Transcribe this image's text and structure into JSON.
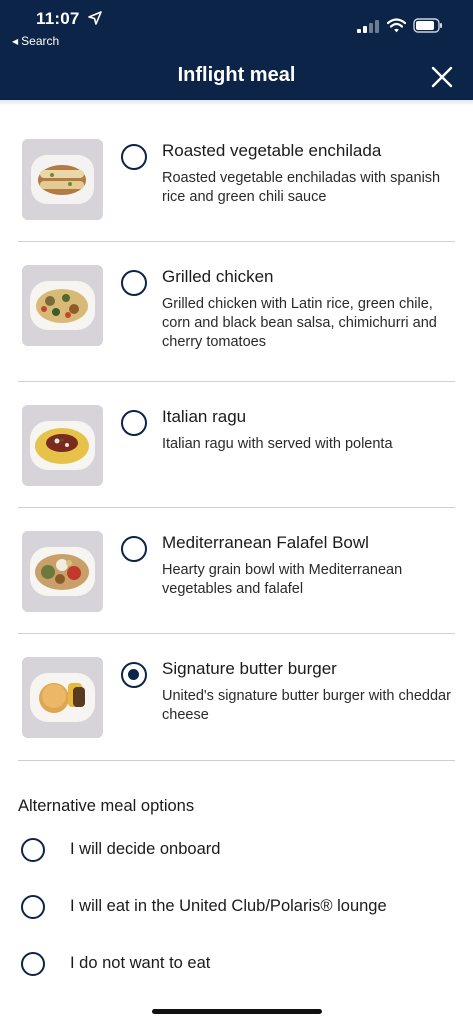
{
  "status_bar": {
    "time": "11:07",
    "back_label": "Search",
    "icons": [
      "location-arrow-icon",
      "cellular-signal-icon",
      "wifi-icon",
      "battery-icon"
    ]
  },
  "header": {
    "title": "Inflight meal",
    "close_icon": "close-icon",
    "background_color": "#0b2447"
  },
  "meals": [
    {
      "name": "Roasted vegetable enchilada",
      "description": "Roasted vegetable enchiladas with spanish rice and green chili sauce",
      "selected": false,
      "image": "enchilada-dish-image"
    },
    {
      "name": "Grilled chicken",
      "description": "Grilled chicken with Latin rice, green chile, corn and black bean salsa, chimichurri and cherry tomatoes",
      "selected": false,
      "image": "grilled-chicken-dish-image"
    },
    {
      "name": "Italian ragu",
      "description": "Italian ragu with served with polenta",
      "selected": false,
      "image": "italian-ragu-dish-image"
    },
    {
      "name": "Mediterranean Falafel Bowl",
      "description": "Hearty grain bowl with Mediterranean vegetables and falafel",
      "selected": false,
      "image": "falafel-bowl-dish-image"
    },
    {
      "name": "Signature butter burger",
      "description": "United's signature butter burger with cheddar cheese",
      "selected": true,
      "image": "butter-burger-dish-image"
    }
  ],
  "alternatives": {
    "heading": "Alternative meal options",
    "options": [
      {
        "label": "I will decide onboard",
        "selected": false
      },
      {
        "label": "I will eat in the United Club/Polaris® lounge",
        "selected": false
      },
      {
        "label": "I do not want to eat",
        "selected": false
      }
    ]
  },
  "colors": {
    "accent": "#0b2447",
    "divider": "#cfcfcf",
    "text": "#1b1b1b"
  }
}
